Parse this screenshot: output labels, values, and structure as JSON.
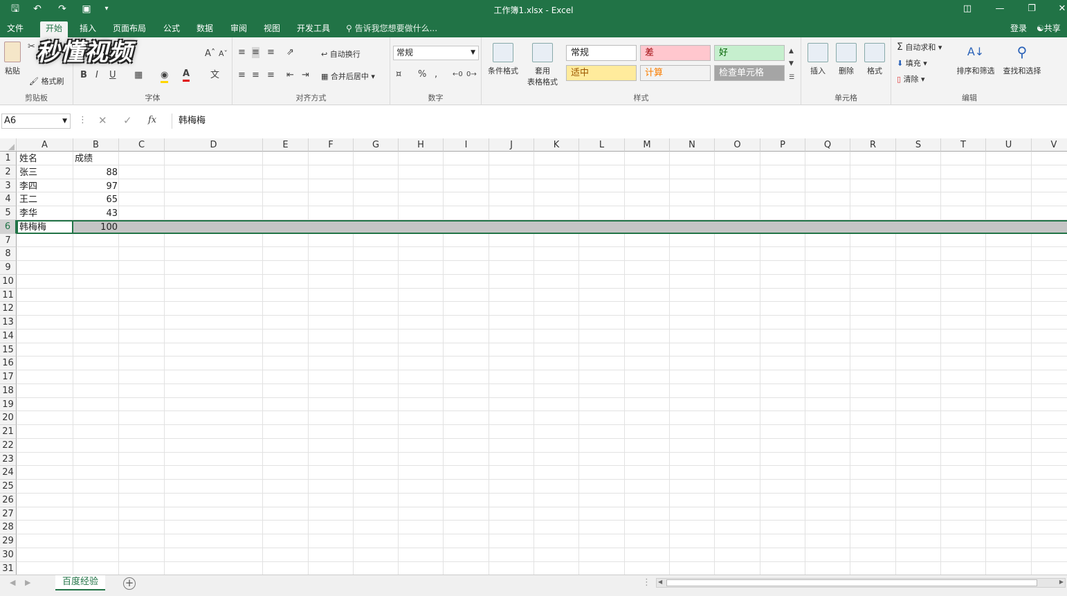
{
  "window": {
    "title": "工作簿1.xlsx - Excel"
  },
  "tabs": [
    "文件",
    "开始",
    "插入",
    "页面布局",
    "公式",
    "数据",
    "审阅",
    "视图",
    "开发工具"
  ],
  "tell_me": "告诉我您想要做什么...",
  "login": "登录",
  "share": "共享",
  "ribbon": {
    "clipboard": {
      "label": "剪贴板",
      "paste": "粘贴",
      "format_painter": "格式刷"
    },
    "font": {
      "label": "字体",
      "bold": "B",
      "italic": "I",
      "underline": "U"
    },
    "alignment": {
      "label": "对齐方式",
      "wrap": "自动换行",
      "merge": "合并后居中"
    },
    "number": {
      "label": "数字",
      "format": "常规",
      "percent": "%",
      "comma": ","
    },
    "styles": {
      "label": "样式",
      "conditional": "条件格式",
      "table_line1": "套用",
      "table_line2": "表格格式",
      "cells": [
        {
          "text": "常规",
          "bg": "#ffffff",
          "fg": "#222222"
        },
        {
          "text": "差",
          "bg": "#ffc7ce",
          "fg": "#9c0006"
        },
        {
          "text": "好",
          "bg": "#c6efce",
          "fg": "#006100"
        },
        {
          "text": "适中",
          "bg": "#ffeb9c",
          "fg": "#9c5700"
        },
        {
          "text": "计算",
          "bg": "#f2f2f2",
          "fg": "#fa7d00"
        },
        {
          "text": "检查单元格",
          "bg": "#a5a5a5",
          "fg": "#ffffff"
        }
      ]
    },
    "cells_grp": {
      "label": "单元格",
      "insert": "插入",
      "delete": "删除",
      "format": "格式"
    },
    "editing": {
      "label": "编辑",
      "autosum": "自动求和",
      "fill": "填充",
      "clear": "清除",
      "sort": "排序和筛选",
      "find": "查找和选择"
    }
  },
  "logo_text": "秒懂视频",
  "formula_bar": {
    "name_box": "A6",
    "fx": "fx",
    "content": "韩梅梅"
  },
  "columns": [
    "A",
    "B",
    "C",
    "D",
    "E",
    "F",
    "G",
    "H",
    "I",
    "J",
    "K",
    "L",
    "M",
    "N",
    "O",
    "P",
    "Q",
    "R",
    "S",
    "T",
    "U",
    "V"
  ],
  "table": {
    "header": [
      "姓名",
      "成绩"
    ],
    "rows": [
      [
        "张三",
        "88"
      ],
      [
        "李四",
        "97"
      ],
      [
        "王二",
        "65"
      ],
      [
        "李华",
        "43"
      ],
      [
        "韩梅梅",
        "100"
      ]
    ]
  },
  "sheet": {
    "tab": "百度经验"
  },
  "colors": {
    "accent": "#217346",
    "selection": "#c5c5c5"
  }
}
